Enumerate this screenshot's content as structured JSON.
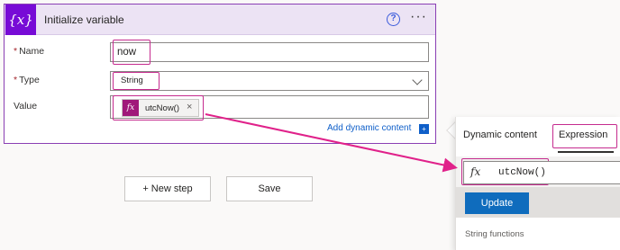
{
  "card": {
    "title": "Initialize variable",
    "icon_glyph": "{x}",
    "icon": "variable-icon",
    "help_glyph": "?",
    "more_glyph": "···",
    "fields": {
      "name_label": "Name",
      "name_value": "now",
      "type_label": "Type",
      "type_value": "String",
      "value_label": "Value",
      "token_glyph": "fx",
      "token_label": "utcNow()",
      "token_close": "×",
      "required_mark": "*"
    },
    "add_dynamic_label": "Add dynamic content",
    "add_dynamic_glyph": "+"
  },
  "buttons": {
    "new_step": "+ New step",
    "save": "Save"
  },
  "panel": {
    "tab_dynamic": "Dynamic content",
    "tab_expression": "Expression",
    "expr_glyph": "fx",
    "expression_value": "utcNow()",
    "update_label": "Update",
    "section_label": "String functions"
  },
  "colors": {
    "accent_purple": "#770bd6",
    "highlight_pink": "#c52b8e",
    "token_magenta": "#a0187a",
    "link_blue": "#0f5fc9",
    "update_blue": "#0f6cbd"
  }
}
